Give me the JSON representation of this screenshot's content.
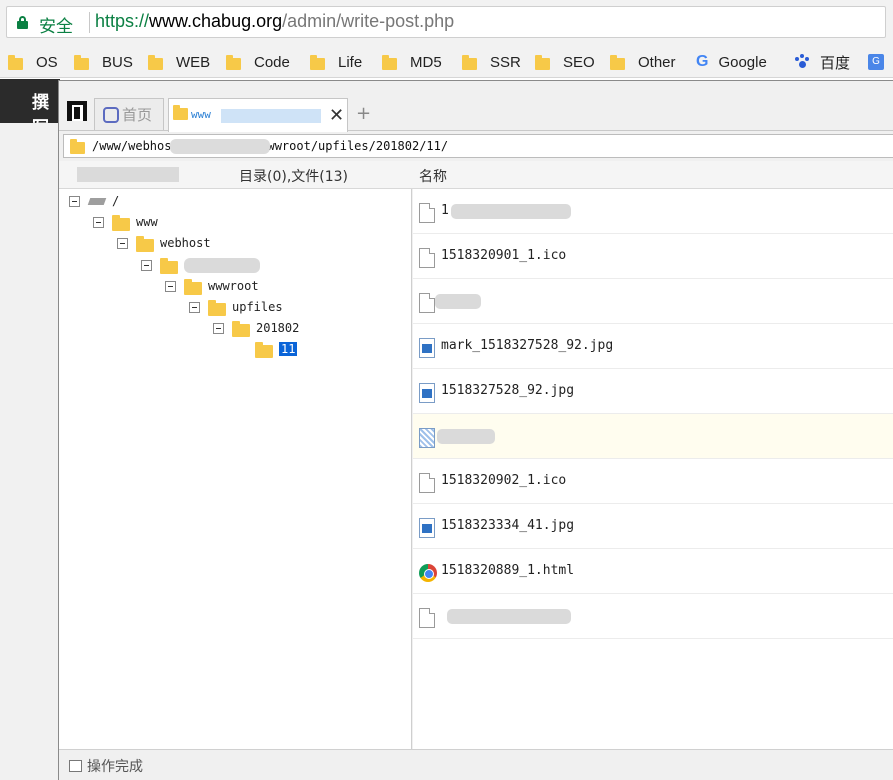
{
  "browser": {
    "secure_label": "安全",
    "url_scheme": "https://",
    "url_host": "www.chabug.org",
    "url_path": "/admin/write-post.php"
  },
  "bookmarks": [
    {
      "label": "OS",
      "icon": "folder-icon"
    },
    {
      "label": "BUS",
      "icon": "folder-icon"
    },
    {
      "label": "WEB",
      "icon": "folder-icon"
    },
    {
      "label": "Code",
      "icon": "folder-icon"
    },
    {
      "label": "Life",
      "icon": "folder-icon"
    },
    {
      "label": "MD5",
      "icon": "folder-icon"
    },
    {
      "label": "SSR",
      "icon": "folder-icon"
    },
    {
      "label": "SEO",
      "icon": "folder-icon"
    },
    {
      "label": "Other",
      "icon": "folder-icon"
    },
    {
      "label": "Google",
      "icon": "google-icon"
    },
    {
      "label": "百度",
      "icon": "baidu-paw-icon"
    }
  ],
  "page": {
    "header_fragment": "撰写"
  },
  "file_manager": {
    "home_tab_label": "首页",
    "active_tab_prefix": "www",
    "path_prefix": "/www/webhos",
    "path_suffix": "wwroot/upfiles/201802/11/",
    "summary": "目录(0),文件(13)",
    "column_name": "名称",
    "status": "操作完成",
    "tree": [
      {
        "label": "/",
        "type": "disk"
      },
      {
        "label": "www",
        "type": "folder"
      },
      {
        "label": "webhost",
        "type": "folder"
      },
      {
        "label": "",
        "type": "folder",
        "redacted": true
      },
      {
        "label": "wwwroot",
        "type": "folder"
      },
      {
        "label": "upfiles",
        "type": "folder"
      },
      {
        "label": "201802",
        "type": "folder"
      },
      {
        "label": "11",
        "type": "folder",
        "selected": true
      }
    ],
    "files": [
      {
        "name": "1",
        "icon": "blank-file-icon",
        "redacted": true
      },
      {
        "name": "1518320901_1.ico",
        "icon": "blank-file-icon"
      },
      {
        "name": "",
        "icon": "blank-file-icon",
        "redacted": true
      },
      {
        "name": "mark_1518327528_92.jpg",
        "icon": "image-file-icon"
      },
      {
        "name": "1518327528_92.jpg",
        "icon": "image-file-icon"
      },
      {
        "name": "",
        "icon": "transparent-image-icon",
        "redacted": true,
        "highlighted": true
      },
      {
        "name": "1518320902_1.ico",
        "icon": "blank-file-icon"
      },
      {
        "name": "1518323334_41.jpg",
        "icon": "image-file-icon"
      },
      {
        "name": "1518320889_1.html",
        "icon": "chrome-html-icon"
      },
      {
        "name": "",
        "icon": "blank-file-icon",
        "redacted": true
      }
    ]
  }
}
